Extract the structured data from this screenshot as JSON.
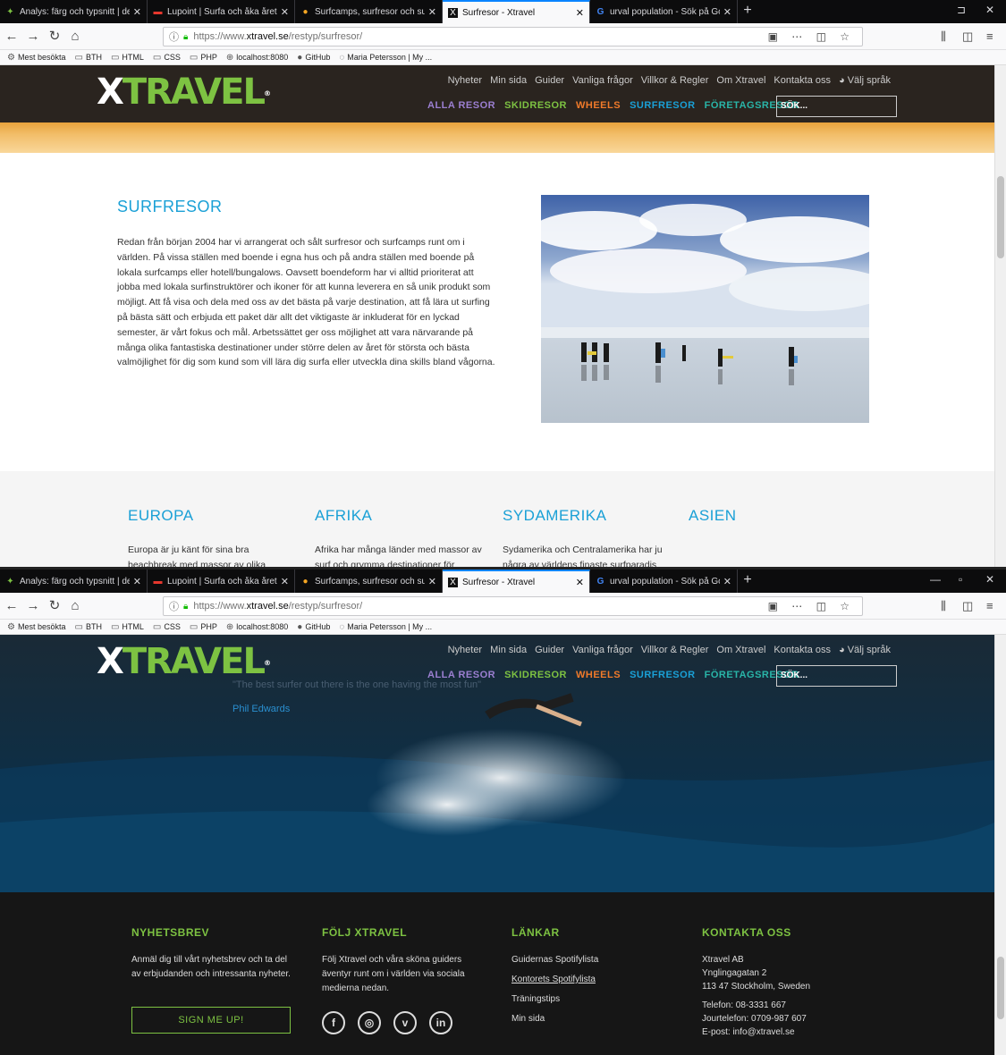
{
  "browser": {
    "tabs": [
      {
        "title": "Analys: färg och typsnitt | desig",
        "favicon": "leaf-icon",
        "color": "#7dc242"
      },
      {
        "title": "Lupoint | Surfa och åka året runt",
        "favicon": "lupoint-icon",
        "color": "#e6372d"
      },
      {
        "title": "Surfcamps, surfresor och surfsko",
        "favicon": "globe-icon",
        "color": "#f5a623"
      },
      {
        "title": "Surfresor - Xtravel",
        "favicon": "xtravel-icon",
        "color": "#111111"
      },
      {
        "title": "urval population - Sök på Goog",
        "favicon": "google-icon",
        "color": "#4285f4"
      }
    ],
    "new_tab": "+",
    "url": {
      "protocol": "https://www.",
      "host": "xtravel.se",
      "path": "/restyp/surfresor/"
    },
    "bookmarks": [
      {
        "label": "Mest besökta",
        "icon": "gear-icon"
      },
      {
        "label": "BTH",
        "icon": "folder-icon"
      },
      {
        "label": "HTML",
        "icon": "folder-icon"
      },
      {
        "label": "CSS",
        "icon": "folder-icon"
      },
      {
        "label": "PHP",
        "icon": "folder-icon"
      },
      {
        "label": "localhost:8080",
        "icon": "globe-icon"
      },
      {
        "label": "GitHub",
        "icon": "github-icon"
      },
      {
        "label": "Maria Petersson | My ...",
        "icon": "profile-icon"
      }
    ]
  },
  "site": {
    "logo": {
      "part1": "X",
      "part2": "TRAVEL",
      "reg": "®"
    },
    "top_nav": [
      "Nyheter",
      "Min sida",
      "Guider",
      "Vanliga frågor",
      "Villkor & Regler",
      "Om Xtravel",
      "Kontakta oss",
      "Välj språk"
    ],
    "main_nav": [
      {
        "label": "ALLA RESOR",
        "color": "#9b7fd1"
      },
      {
        "label": "SKIDRESOR",
        "color": "#7dc242"
      },
      {
        "label": "WHEELS",
        "color": "#f07a2a"
      },
      {
        "label": "SURFRESOR",
        "color": "#1aa0d6"
      },
      {
        "label": "FÖRETAGSRESOR",
        "color": "#29b5a8"
      }
    ],
    "search_placeholder": "SÖK...",
    "intro": {
      "title": "SURFRESOR",
      "body": "Redan från början 2004 har vi arrangerat och sålt surfresor och surfcamps runt om i världen. På vissa ställen med boende i egna hus och på andra ställen med boende på lokala surfcamps eller hotell/bungalows. Oavsett boendeform har vi alltid prioriterat att jobba med lokala surfinstruktörer och ikoner för att kunna leverera en så unik produkt som möjligt. Att få visa och dela med oss av det bästa på varje destination, att få lära ut surfing på bästa sätt och erbjuda ett paket där allt det viktigaste är inkluderat för en lyckad semester, är vårt fokus och mål. Arbetssättet ger oss möjlighet att vara närvarande på många olika fantastiska destinationer under större delen av året för största och bästa valmöjlighet för dig som kund som vill lära dig surfa eller utveckla dina skills bland vågorna."
    },
    "regions": [
      {
        "title": "EUROPA",
        "text": "Europa är ju känt för sina bra beachbreak med massor av olika"
      },
      {
        "title": "AFRIKA",
        "text": "Afrika har många länder med massor av surf och grymma destinationer för"
      },
      {
        "title": "SYDAMERIKA",
        "text": "Sydamerika och Centralamerika har ju några av världens finaste surfparadis"
      },
      {
        "title": "ASIEN",
        "text": ""
      }
    ],
    "hero": {
      "quote": "\"The best surfer out there is the one having the most fun\"",
      "author": "Phil Edwards"
    },
    "footer": {
      "newsletter": {
        "title": "NYHETSBREV",
        "text": "Anmäl dig till vårt nyhetsbrev och ta del av erbjudanden och intressanta nyheter.",
        "button": "SIGN ME UP!"
      },
      "follow": {
        "title": "FÖLJ XTRAVEL",
        "text": "Följ Xtravel och våra sköna guiders äventyr runt om i världen via sociala medierna nedan.",
        "icons": [
          "f",
          "◎",
          "v",
          "in"
        ]
      },
      "links": {
        "title": "LÄNKAR",
        "items": [
          "Guidernas Spotifylista",
          "Kontorets Spotifylista",
          "Träningstips",
          "Min sida"
        ]
      },
      "contact": {
        "title": "KONTAKTA OSS",
        "lines": [
          "Xtravel AB",
          "Ynglingagatan 2",
          "113 47 Stockholm, Sweden"
        ],
        "phone": "Telefon: 08-3331 667",
        "jour": "Jourtelefon: 0709-987 607",
        "email": "E-post: info@xtravel.se"
      }
    }
  }
}
